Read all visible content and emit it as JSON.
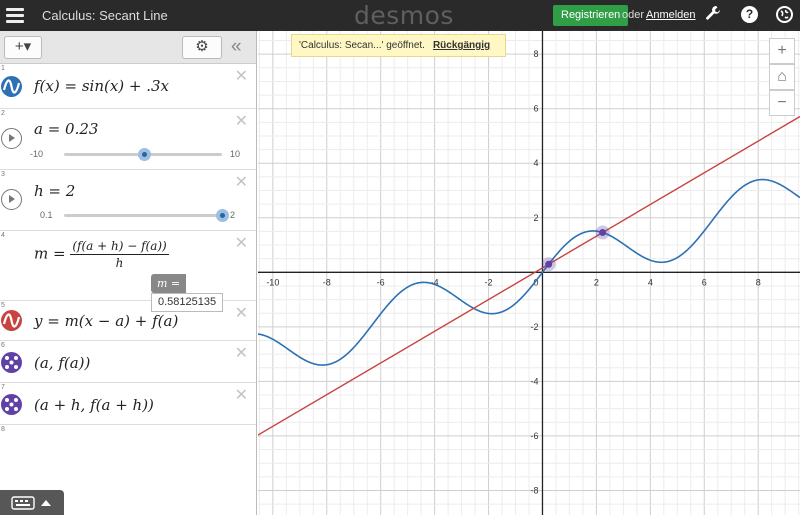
{
  "header": {
    "title": "Calculus: Secant Line",
    "logo": "desmos",
    "register_label": "Registrieren",
    "or_label": "oder",
    "login_label": "Anmelden",
    "help_glyph": "?"
  },
  "toolbar": {
    "add_label": "+▾",
    "settings_glyph": "⚙",
    "collapse_glyph": "«"
  },
  "expressions": [
    {
      "index": "1",
      "latex": "f(x) = sin(x) + .3x",
      "color": "#2d70b3",
      "icon": "wave-icon"
    },
    {
      "index": "2",
      "latex": "a = 0.23",
      "slider": {
        "min": "-10",
        "max": "10",
        "value": 0.23
      },
      "icon": "play-icon"
    },
    {
      "index": "3",
      "latex": "h = 2",
      "slider": {
        "min": "0.1",
        "max": "2",
        "value": 2
      },
      "icon": "play-icon"
    },
    {
      "index": "4",
      "m_label": "m",
      "m_num": "(f(a + h) − f(a))",
      "m_den": "h",
      "value_label": "m =",
      "value": "0.58125135"
    },
    {
      "index": "5",
      "latex": "y = m(x − a) + f(a)",
      "color": "#c74440",
      "icon": "wave-icon"
    },
    {
      "index": "6",
      "latex": "(a, f(a))",
      "color": "#6042a6",
      "icon": "points-icon"
    },
    {
      "index": "7",
      "latex": "(a + h, f(a + h))",
      "color": "#6042a6",
      "icon": "points-icon"
    },
    {
      "index": "8"
    }
  ],
  "toast": {
    "message": "'Calculus: Secan...' geöffnet.",
    "undo_label": "Rückgängig"
  },
  "zoom": {
    "in": "+",
    "home": "⌂",
    "out": "−"
  },
  "graph": {
    "xmin": -10.55,
    "xmax": 9.55,
    "ymin": -8.9,
    "ymax": 8.85,
    "x_ticks": [
      -10,
      -8,
      -6,
      -4,
      -2,
      2,
      4,
      6,
      8
    ],
    "y_ticks": [
      -8,
      -6,
      -4,
      -2,
      2,
      4,
      6,
      8
    ],
    "origin_label": "0",
    "a": 0.23,
    "h": 2,
    "m": 0.58125135,
    "curve_color": "#2d70b3",
    "line_color": "#c74440",
    "point_color": "#6042a6"
  }
}
